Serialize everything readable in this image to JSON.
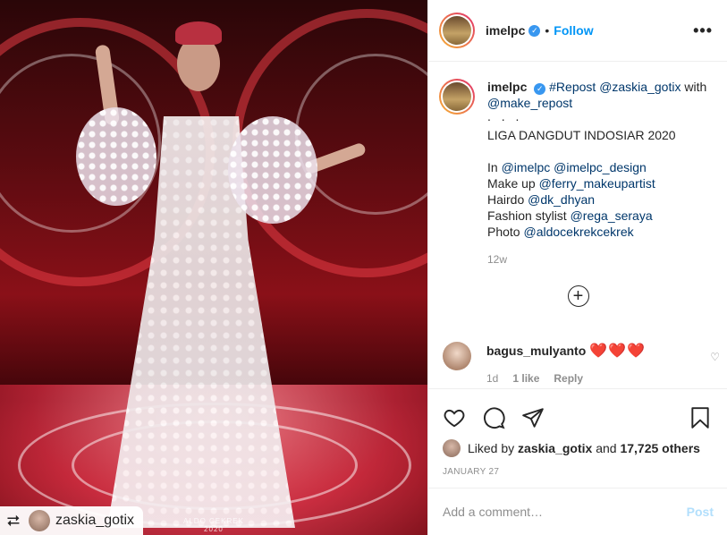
{
  "post": {
    "username": "imelpc",
    "follow_label": "Follow",
    "more_label": "•••",
    "repost": {
      "username": "zaskia_gotix",
      "icon": "repost-icon"
    },
    "watermark_line1": "ALDO CEKREK",
    "watermark_line2": "2020"
  },
  "caption": {
    "username": "imelpc",
    "text_start": "#Repost",
    "mention1": "@zaskia_gotix",
    "with": "with",
    "mention2": "@make_repost",
    "dots": ". . .",
    "title": "LIGA DANGDUT INDOSIAR 2020",
    "lines": [
      {
        "label": "In",
        "mentions": "@imelpc @imelpc_design"
      },
      {
        "label": "Make up",
        "mentions": "@ferry_makeupartist"
      },
      {
        "label": "Hairdo",
        "mentions": "@dk_dhyan"
      },
      {
        "label": "Fashion stylist",
        "mentions": "@rega_seraya"
      },
      {
        "label": "Photo",
        "mentions": "@aldocekrekcekrek"
      }
    ],
    "time": "12w"
  },
  "load_more_icon": "plus-circle-icon",
  "comment": {
    "username": "bagus_mulyanto",
    "text": "❤️❤️❤️",
    "age": "1d",
    "likes": "1 like",
    "reply": "Reply"
  },
  "likes": {
    "prefix": "Liked by",
    "user": "zaskia_gotix",
    "and": "and",
    "others": "17,725 others"
  },
  "date": "JANUARY 27",
  "add_comment": {
    "placeholder": "Add a comment…",
    "post_label": "Post"
  },
  "colors": {
    "link": "#00376b",
    "follow": "#0095f6",
    "muted": "#8e8e8e",
    "post_disabled": "#b2dffc"
  }
}
